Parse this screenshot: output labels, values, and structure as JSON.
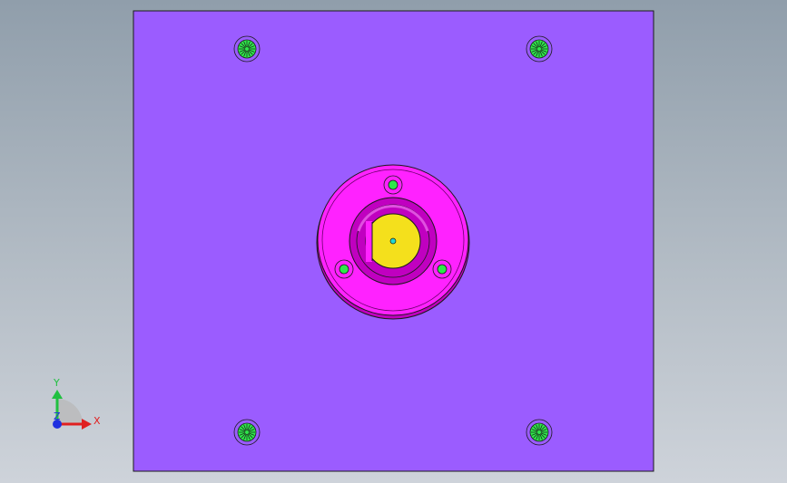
{
  "scene": {
    "background_top": "#909eab",
    "background_bottom": "#ced3da",
    "plate_color": "#9b5cff",
    "flange_color": "#ff22ff",
    "flange_shadow": "#c000c0",
    "bore_color": "#f4e01c",
    "hole_color": "#2ee84a",
    "center_point_color": "#22d8d0",
    "outline_color": "#1a1a1a"
  },
  "triad": {
    "x_label": "X",
    "y_label": "Y",
    "z_label": "Z",
    "x_color": "#e02020",
    "y_color": "#20c040",
    "z_color": "#2030e0"
  }
}
